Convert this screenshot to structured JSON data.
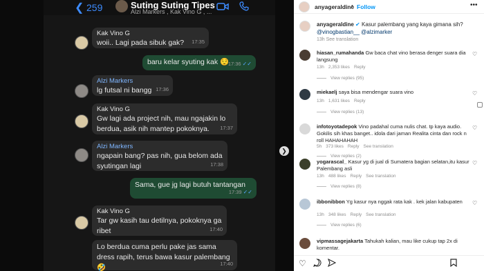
{
  "chat": {
    "back_count": "259",
    "title": "Suting Suting Tipes",
    "subtitle": "Alzi Markers , Kak Vino G , ...",
    "messages": [
      {
        "sender": "Kak Vino G",
        "text": "woii.. Lagi pada sibuk gak?",
        "time": "17:35"
      },
      {
        "text": "baru kelar syuting kak 😌",
        "time": "17:36"
      },
      {
        "sender": "Alzi Markers",
        "text": "lg futsal ni bangg",
        "time": "17:36"
      },
      {
        "sender": "Kak Vino G",
        "text": "Gw lagi ada project nih, mau ngajakin lo berdua, asik nih mantep pokoknya.",
        "time": "17:37"
      },
      {
        "sender": "Alzi Markers",
        "text": "ngapain bang? pas nih, gua belom ada syutingan lagi",
        "time": "17:38"
      },
      {
        "text": "Sama, gue jg lagi butuh tantangan",
        "time": "17:39"
      },
      {
        "sender": "Kak Vino G",
        "text": "Tar gw kasih tau detilnya, pokoknya ga ribet",
        "time": "17:40"
      },
      {
        "text": "Lo berdua cuma perlu pake jas sama dress rapih, terus bawa kasur palembang 🤣",
        "time": "17:40"
      }
    ],
    "sender_colors": {
      "Kak Vino G": "#e8e8e8",
      "Alzi Markers": "#7fb6ff"
    }
  },
  "instagram": {
    "username": "anyageraldine",
    "follow_label": "Follow",
    "caption_user": "anyageraldine",
    "caption_text": "Kasur palembang yang kaya gimana sih?",
    "caption_mentions": "@vinogbastian__ @alzimarker",
    "caption_meta": "13h  See translation",
    "comments": [
      {
        "user": "hiasan_rumahanda",
        "text": "Gw baca chat vino berasa denger suara dia langsung",
        "time": "13h",
        "likes": "2,353 likes",
        "reply": "Reply",
        "replies": "View replies (95)",
        "avatar_color": "#4a3d33"
      },
      {
        "user": "miekaelj",
        "text": "saya bisa mendengar suara vino",
        "time": "13h",
        "likes": "1,631 likes",
        "reply": "Reply",
        "replies": "View replies (13)",
        "avatar_color": "#2f3a44"
      },
      {
        "user": "infotoyotadepok",
        "text": "Vino padahal cuma nulis chat. tp kaya audio. Gokilis sih khas banget.. idola dari jaman Realita cinta dan rock n roll HAHAHAHAH",
        "time": "5h",
        "likes": "373 likes",
        "reply": "Reply",
        "translation": "See translation",
        "replies": "View replies (2)",
        "avatar_color": "#d9d9d9"
      },
      {
        "user": "yogarascal_",
        "text": "Kasur yg di jual di Sumatera bagian selatan,itu kasur Palembang asli",
        "time": "13h",
        "likes": "488 likes",
        "reply": "Reply",
        "translation": "See translation",
        "replies": "View replies (8)",
        "avatar_color": "#3b3f2a"
      },
      {
        "user": "ibbonibbon",
        "text": "Yg kasur nya nggak rata kak . kek jalan kabupaten",
        "time": "13h",
        "likes": "348 likes",
        "reply": "Reply",
        "translation": "See translation",
        "replies": "View replies (6)",
        "avatar_color": "#b8c7d6"
      },
      {
        "user": "vipmassagejakarta",
        "text": "Tahukah kalian, mau like cukup tap 2x di komentar.",
        "time": "",
        "likes": "",
        "reply": "",
        "replies": "",
        "avatar_color": "#6b4d3d"
      }
    ]
  }
}
